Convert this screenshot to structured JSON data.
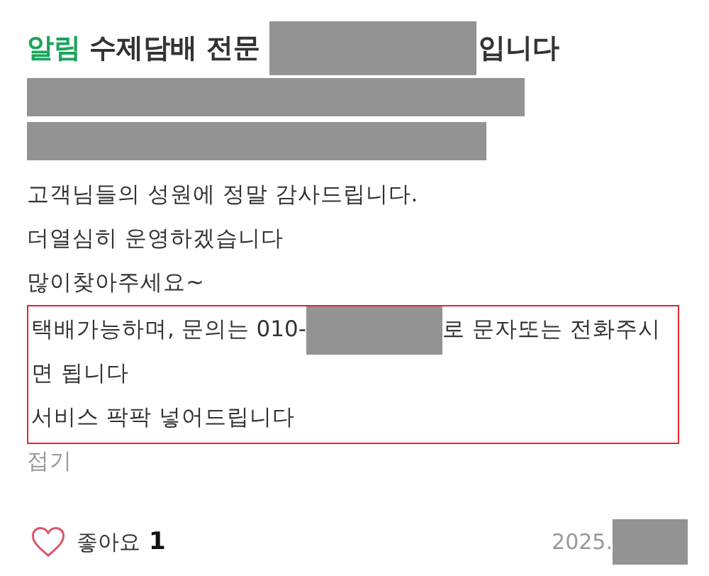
{
  "title": [
    {
      "kind": "highlight",
      "text": "알림"
    },
    {
      "kind": "text",
      "text": "수제담배 전문"
    },
    {
      "kind": "redacted"
    },
    {
      "kind": "text",
      "text": "입니다"
    }
  ],
  "hidden_lines": [
    {
      "kind": "redacted"
    },
    {
      "kind": "redacted"
    }
  ],
  "body": [
    [
      {
        "kind": "text",
        "text": "고객님들의 성원에 정말 감사드립니다."
      }
    ],
    [
      {
        "kind": "text",
        "text": "더열심히 운영하겠습니다"
      }
    ],
    [
      {
        "kind": "text",
        "text": "많이찾아주세요~"
      }
    ]
  ],
  "boxed_body": [
    [
      {
        "kind": "text",
        "text": "택배가능하며, 문의는 010-"
      },
      {
        "kind": "redacted"
      },
      {
        "kind": "text",
        "text": "로 문자또는 전화주시"
      }
    ],
    [
      {
        "kind": "text",
        "text": "면 됩니다"
      }
    ],
    [
      {
        "kind": "text",
        "text": "서비스 팍팍 넣어드립니다"
      }
    ]
  ],
  "collapse_link": "접기",
  "likes": {
    "label": "좋아요",
    "count": "1",
    "liked": false
  },
  "date": [
    {
      "kind": "text",
      "text": "2025."
    },
    {
      "kind": "redacted"
    }
  ]
}
